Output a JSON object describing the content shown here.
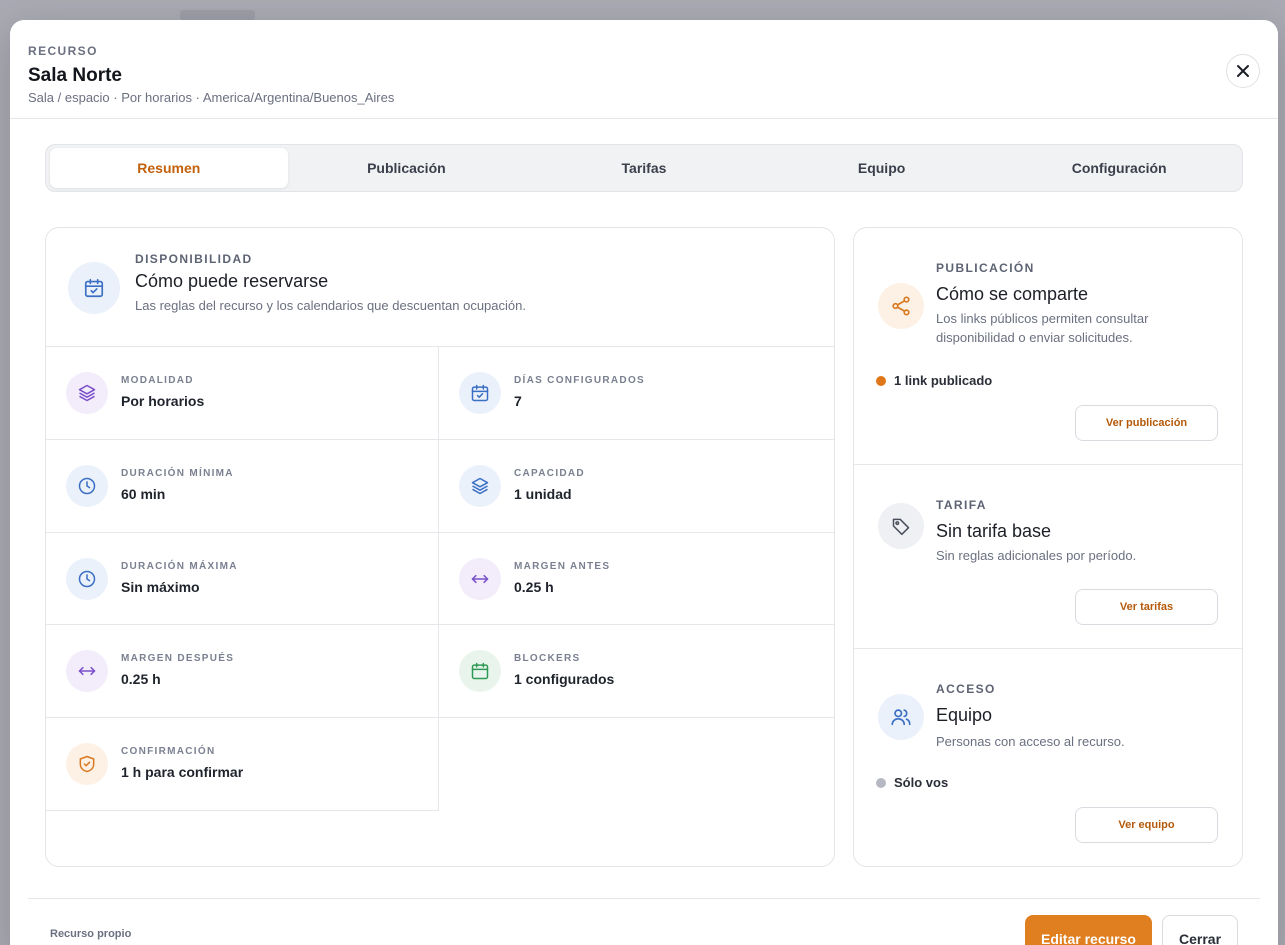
{
  "header": {
    "eyebrow": "RECURSO",
    "title": "Sala Norte",
    "subtitle": "Sala / espacio · Por horarios · America/Argentina/Buenos_Aires"
  },
  "tabs": [
    {
      "label": "Resumen",
      "active": true
    },
    {
      "label": "Publicación",
      "active": false
    },
    {
      "label": "Tarifas",
      "active": false
    },
    {
      "label": "Equipo",
      "active": false
    },
    {
      "label": "Configuración",
      "active": false
    }
  ],
  "availability": {
    "eyebrow": "DISPONIBILIDAD",
    "title": "Cómo puede reservarse",
    "description": "Las reglas del recurso y los calendarios que descuentan ocupación.",
    "items": [
      {
        "label": "MODALIDAD",
        "value": "Por horarios",
        "icon": "layers-icon"
      },
      {
        "label": "DÍAS CONFIGURADOS",
        "value": "7",
        "icon": "calendar-check-icon"
      },
      {
        "label": "DURACIÓN MÍNIMA",
        "value": "60 min",
        "icon": "clock-icon"
      },
      {
        "label": "CAPACIDAD",
        "value": "1 unidad",
        "icon": "layers-icon"
      },
      {
        "label": "DURACIÓN MÁXIMA",
        "value": "Sin máximo",
        "icon": "clock-icon"
      },
      {
        "label": "MARGEN ANTES",
        "value": "0.25 h",
        "icon": "arrows-horizontal-icon"
      },
      {
        "label": "MARGEN DESPUÉS",
        "value": "0.25 h",
        "icon": "arrows-horizontal-icon"
      },
      {
        "label": "BLOCKERS",
        "value": "1 configurados",
        "icon": "calendar-icon"
      },
      {
        "label": "CONFIRMACIÓN",
        "value": "1 h para confirmar",
        "icon": "shield-check-icon"
      }
    ]
  },
  "publication": {
    "eyebrow": "PUBLICACIÓN",
    "title": "Cómo se comparte",
    "description": "Los links públicos permiten consultar disponibilidad o enviar solicitudes.",
    "status": "1 link publicado",
    "status_color": "#e0761a",
    "button": "Ver publicación"
  },
  "rate": {
    "eyebrow": "TARIFA",
    "title": "Sin tarifa base",
    "description": "Sin reglas adicionales por período.",
    "button": "Ver tarifas"
  },
  "access": {
    "eyebrow": "ACCESO",
    "title": "Equipo",
    "description": "Personas con acceso al recurso.",
    "status": "Sólo vos",
    "status_color": "#b6b9c1",
    "button": "Ver equipo"
  },
  "footer": {
    "note": "Recurso propio",
    "primary": "Editar recurso",
    "secondary": "Cerrar"
  },
  "colors": {
    "accent": "#e07f1f",
    "accent_text": "#c2610c"
  }
}
